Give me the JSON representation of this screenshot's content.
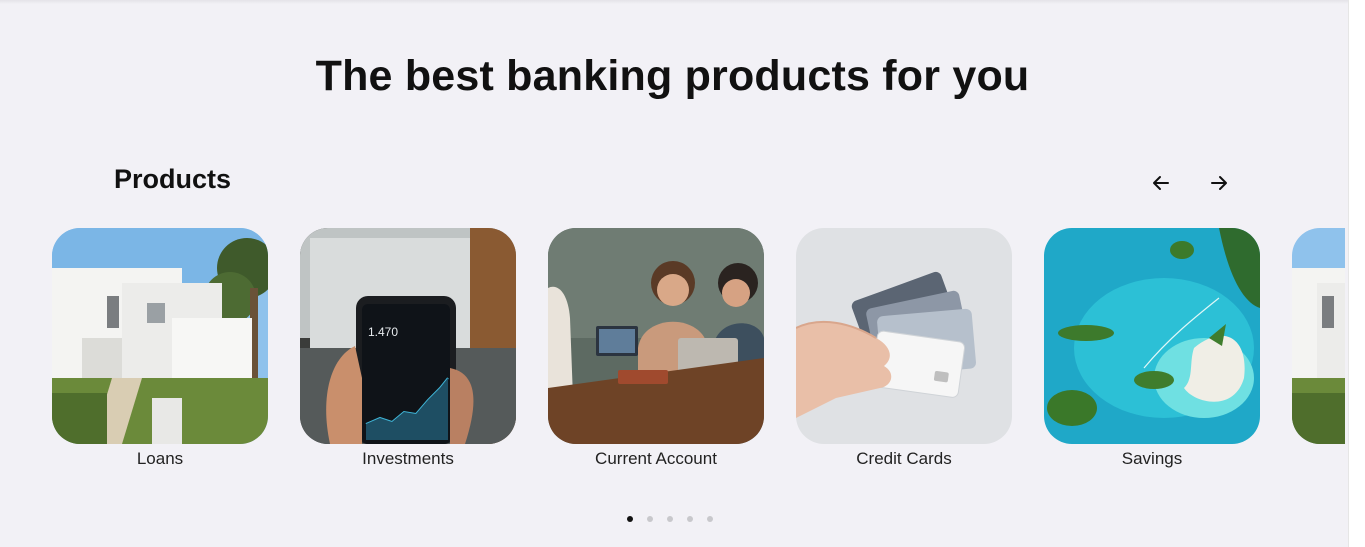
{
  "heading": "The best banking products for you",
  "section": {
    "title": "Products",
    "prev_icon": "arrow-left-icon",
    "next_icon": "arrow-right-icon"
  },
  "products": [
    {
      "label": "Loans",
      "image": "white-house-photo"
    },
    {
      "label": "Investments",
      "image": "stock-app-phone-photo"
    },
    {
      "label": "Current Account",
      "image": "people-at-laptops-photo"
    },
    {
      "label": "Credit Cards",
      "image": "hand-holding-cards-photo"
    },
    {
      "label": "Savings",
      "image": "tropical-islands-photo"
    }
  ],
  "pagination": {
    "count": 5,
    "active": 1
  },
  "colors": {
    "background": "#f2f1f6",
    "text": "#111111",
    "dot_inactive": "#c8c8cc"
  }
}
